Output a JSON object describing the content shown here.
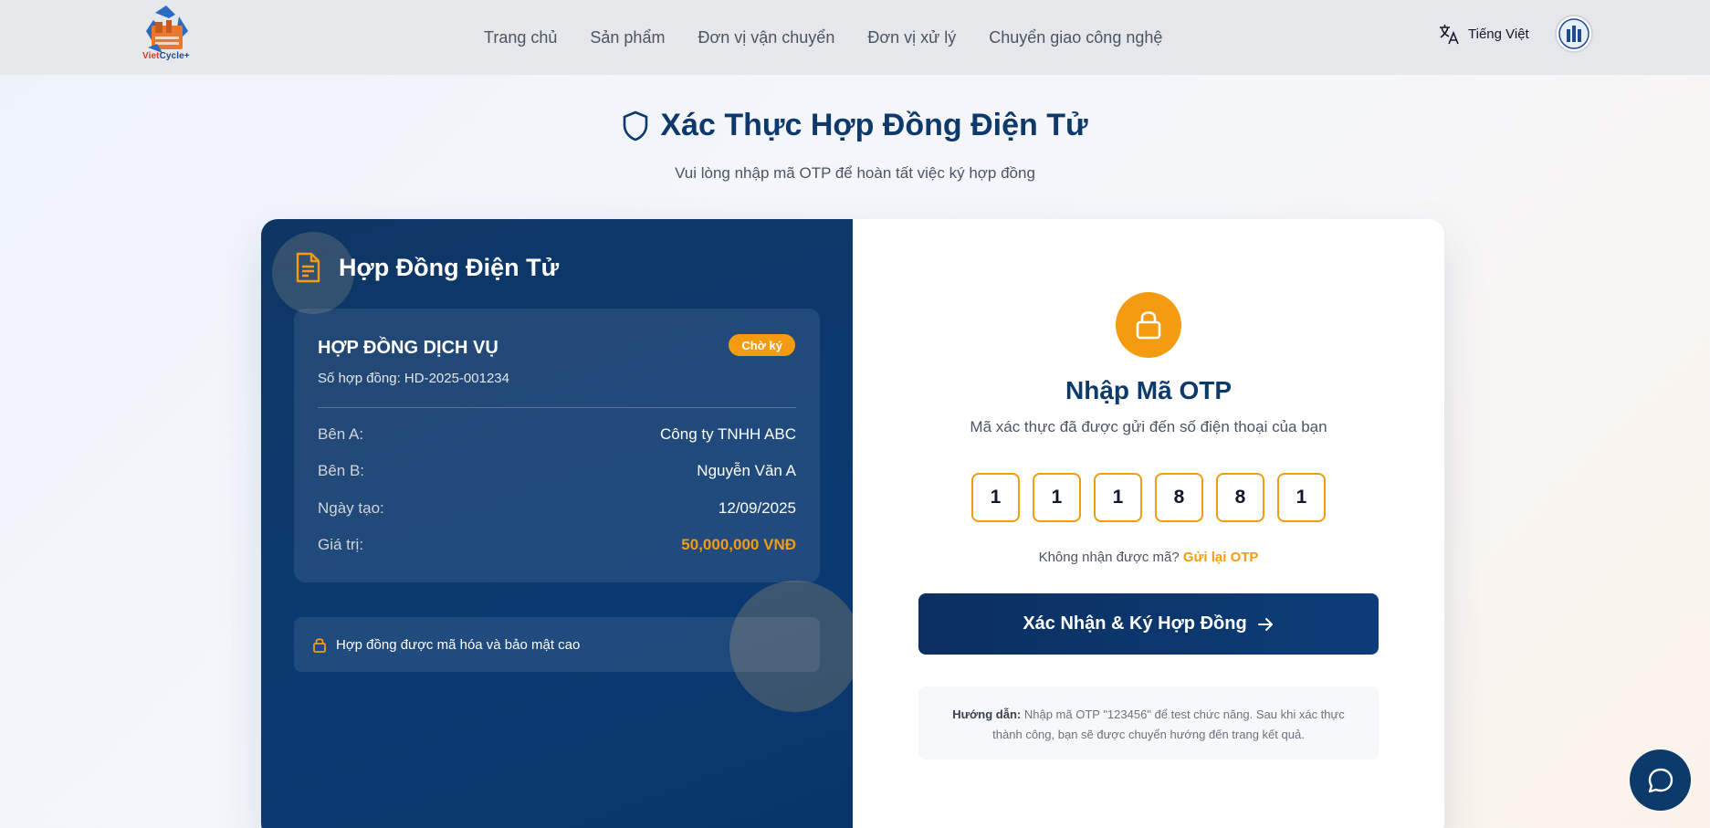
{
  "brand": {
    "name_prefix": "Viet",
    "name_suffix": "Cycle+"
  },
  "nav": {
    "items": [
      "Trang chủ",
      "Sản phẩm",
      "Đơn vị vận chuyển",
      "Đơn vị xử lý",
      "Chuyển giao công nghệ"
    ],
    "language": "Tiếng Việt",
    "language_icon": "translate-icon"
  },
  "page": {
    "title": "Xác Thực Hợp Đồng Điện Tử",
    "subtitle": "Vui lòng nhập mã OTP để hoàn tất việc ký hợp đồng"
  },
  "contract": {
    "section_title": "Hợp Đồng Điện Tử",
    "type": "HỢP ĐỒNG DỊCH VỤ",
    "status": "Chờ ký",
    "number": "Số hợp đồng: HD-2025-001234",
    "rows": [
      {
        "label": "Bên A:",
        "value": "Công ty TNHH ABC"
      },
      {
        "label": "Bên B:",
        "value": "Nguyễn Văn A"
      },
      {
        "label": "Ngày tạo:",
        "value": "12/09/2025"
      },
      {
        "label": "Giá trị:",
        "value": "50,000,000 VNĐ"
      }
    ],
    "security_note": "Hợp đồng được mã hóa và bảo mật cao"
  },
  "otp": {
    "title": "Nhập Mã OTP",
    "subtitle": "Mã xác thực đã được gửi đến số điện thoại của bạn",
    "digits": [
      "1",
      "1",
      "1",
      "8",
      "8",
      "1"
    ],
    "resend_prompt": "Không nhận được mã?",
    "resend_link": "Gửi lại OTP",
    "submit_label": "Xác Nhận & Ký Hợp Đồng",
    "guide_label": "Hướng dẫn:",
    "guide_text": "Nhập mã OTP \"123456\" để test chức năng. Sau khi xác thực thành công, bạn sẽ được chuyển hướng đến trang kết quả."
  },
  "colors": {
    "primary": "#0e3a6b",
    "accent": "#f39c12"
  }
}
